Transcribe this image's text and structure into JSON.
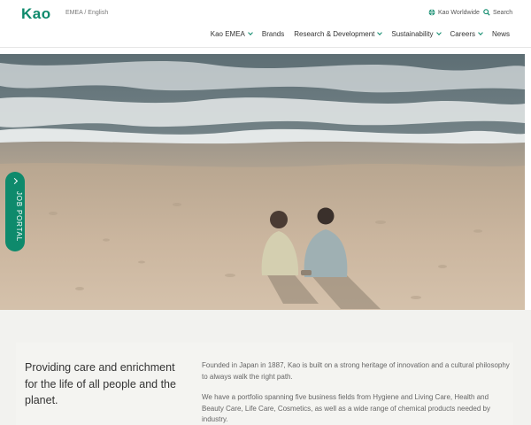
{
  "header": {
    "logo": "Kao",
    "region": "EMEA / English",
    "worldwide_label": "Kao Worldwide",
    "search_label": "Search"
  },
  "nav": {
    "items": [
      {
        "label": "Kao EMEA",
        "has_dropdown": true
      },
      {
        "label": "Brands",
        "has_dropdown": false
      },
      {
        "label": "Research & Development",
        "has_dropdown": true
      },
      {
        "label": "Sustainability",
        "has_dropdown": true
      },
      {
        "label": "Careers",
        "has_dropdown": true
      },
      {
        "label": "News",
        "has_dropdown": false
      }
    ]
  },
  "job_portal": {
    "label": "JOB PORTAL"
  },
  "intro": {
    "tagline": "Providing care and enrichment for the life of all people and the planet.",
    "paragraph1": "Founded in Japan in 1887, Kao is built on a strong heritage of innovation and a cultural philosophy to always walk the right path.",
    "paragraph2": "We have a portfolio spanning five business fields from Hygiene and Living Care, Health and Beauty Care, Life Care, Cosmetics, as well as a wide range of chemical products needed by industry."
  },
  "colors": {
    "brand": "#0e8a6c",
    "sand": "#c9b49d",
    "sea": "#7f8e92",
    "section_bg": "#f2f2ef"
  },
  "icons": {
    "worldwide": "globe-icon",
    "search": "search-icon",
    "dropdown": "chevron-down-icon",
    "job_portal": "chevron-up-icon"
  }
}
